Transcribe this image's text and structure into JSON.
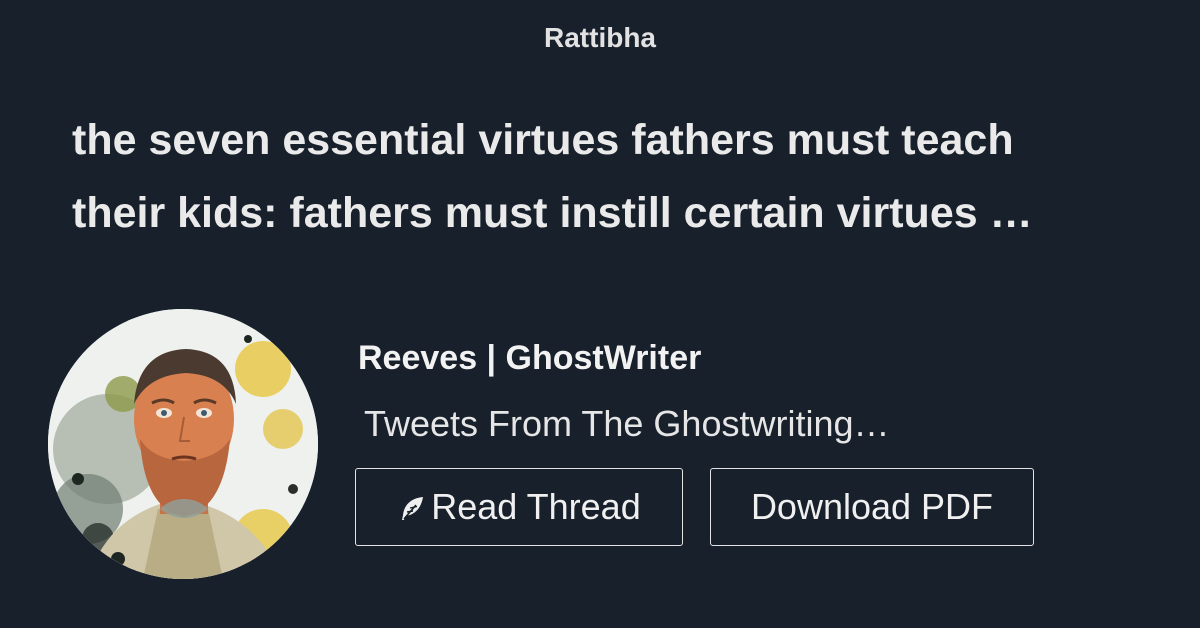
{
  "site": {
    "name": "Rattibha"
  },
  "thread": {
    "title_line1": "the seven essential virtues fathers must teach",
    "title_line2": "their kids: fathers must instill certain virtues …"
  },
  "author": {
    "name": "Reeves | GhostWriter",
    "bio": "Tweets From The Ghostwriting…"
  },
  "actions": {
    "read_label": "Read Thread",
    "read_icon": "feather-icon",
    "pdf_label": "Download PDF"
  },
  "colors": {
    "background": "#18202c",
    "text": "#ececec",
    "button_border": "#e3e3e3"
  }
}
